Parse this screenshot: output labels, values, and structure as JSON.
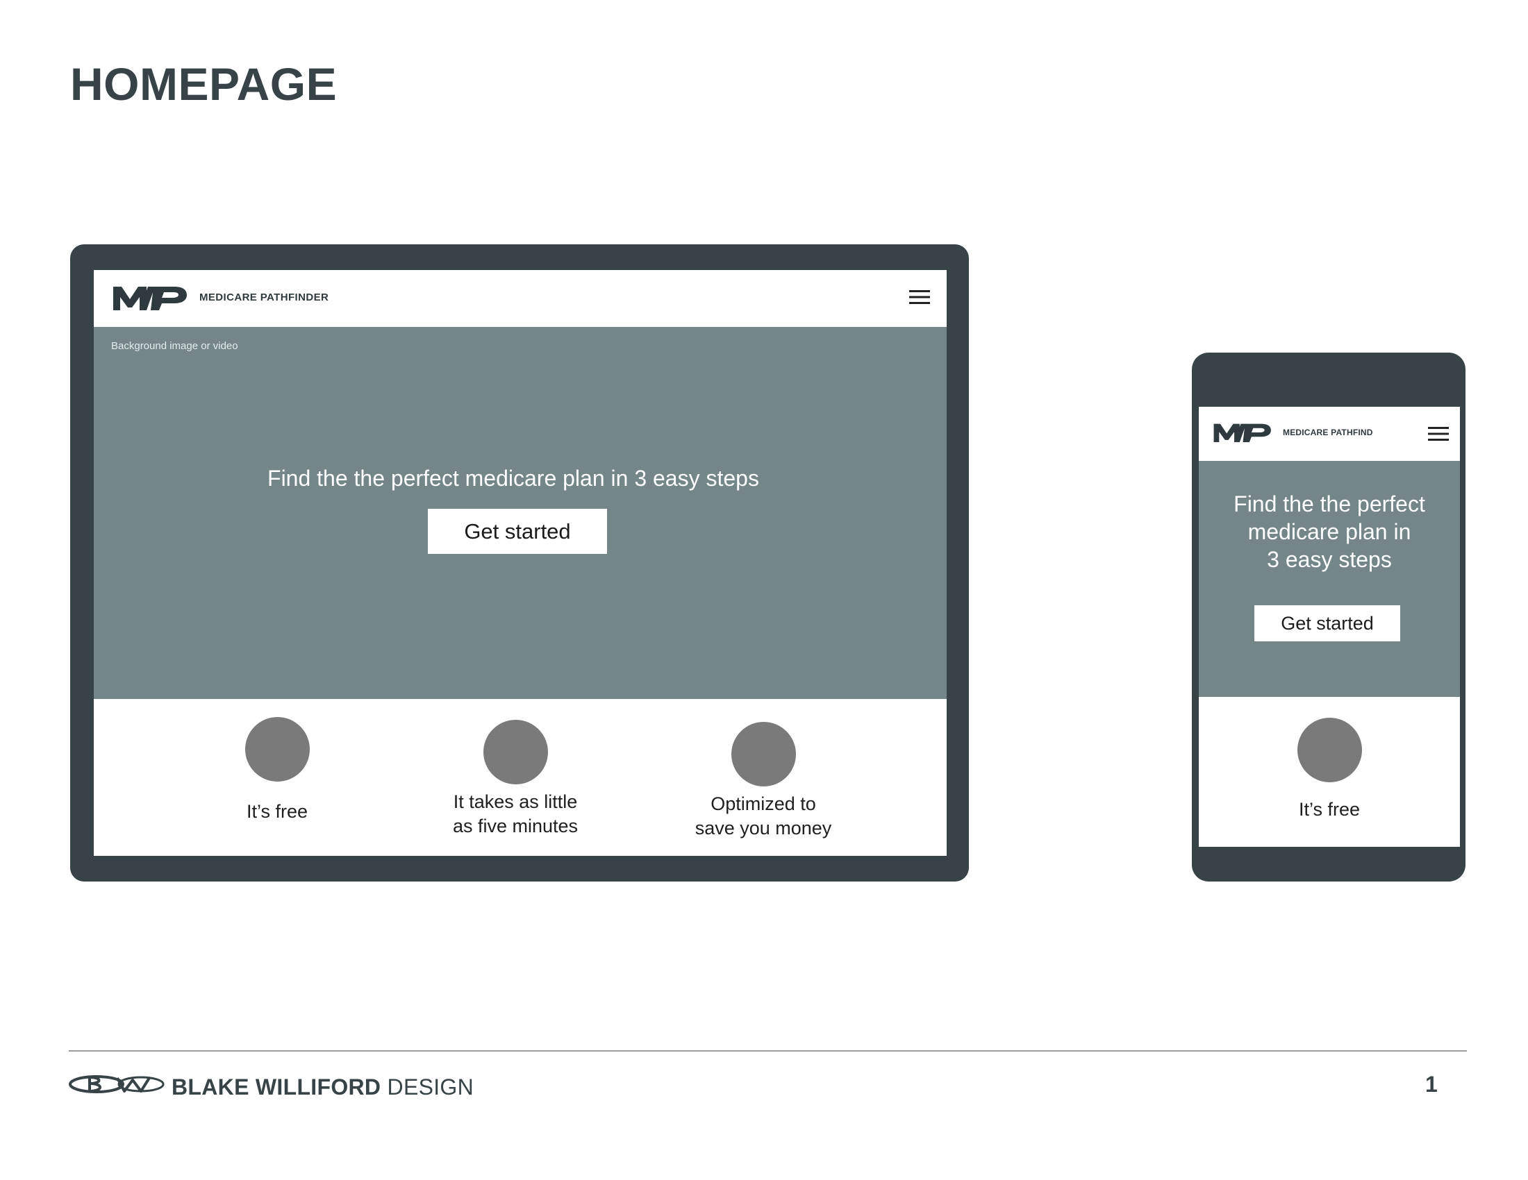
{
  "page": {
    "title": "HOMEPAGE",
    "page_number": "1"
  },
  "tablet": {
    "logo_mark": "MP",
    "brand_name": "MEDICARE PATHFINDER",
    "background_note": "Background image or video",
    "hero_headline": "Find the the perfect medicare plan in 3 easy steps",
    "cta_label": "Get started",
    "features": [
      {
        "label": "It’s free"
      },
      {
        "label": "It takes as little\nas five minutes"
      },
      {
        "label": "Optimized to\nsave you money"
      }
    ]
  },
  "phone": {
    "logo_mark": "MP",
    "brand_name": "MEDICARE PATHFIND",
    "hero_headline": "Find the the perfect\nmedicare plan in\n3 easy steps",
    "cta_label": "Get started",
    "features": [
      {
        "label": "It’s free"
      }
    ]
  },
  "footer": {
    "logo_mark": "BW",
    "brand_bold": "BLAKE WILLIFORD",
    "brand_light": "DESIGN"
  },
  "colors": {
    "frame": "#384347",
    "hero": "#758689",
    "feature_circle": "#7a7a7a",
    "title_text": "#384347"
  },
  "icons": {
    "menu": "hamburger-menu-icon",
    "logo": "mp-logo-icon",
    "footer_logo": "bw-logo-icon"
  }
}
